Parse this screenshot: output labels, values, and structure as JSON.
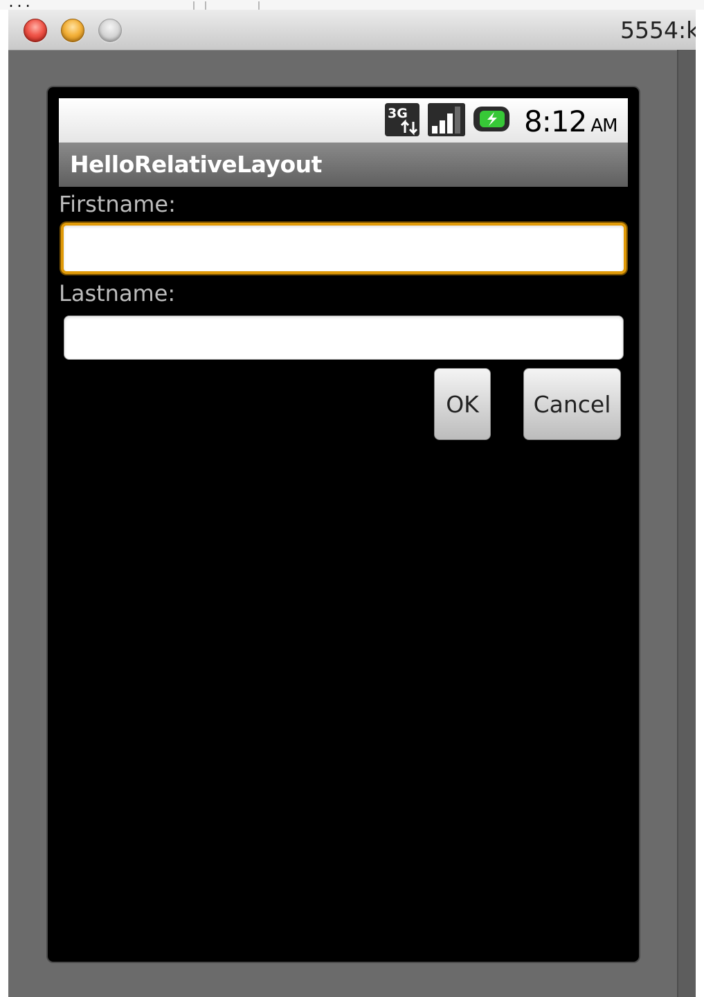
{
  "window": {
    "title": "5554:k"
  },
  "statusbar": {
    "network_icon": "3g-data-icon",
    "signal_icon": "signal-bars-icon",
    "battery_icon": "battery-charging-icon",
    "time": "8:12",
    "ampm": "AM"
  },
  "app": {
    "title": "HelloRelativeLayout"
  },
  "form": {
    "firstname_label": "Firstname:",
    "firstname_value": "",
    "lastname_label": "Lastname:",
    "lastname_value": "",
    "ok_label": "OK",
    "cancel_label": "Cancel"
  },
  "colors": {
    "focus_border": "#e09a08",
    "screen_background": "#000000",
    "window_background": "#6b6b6b"
  }
}
